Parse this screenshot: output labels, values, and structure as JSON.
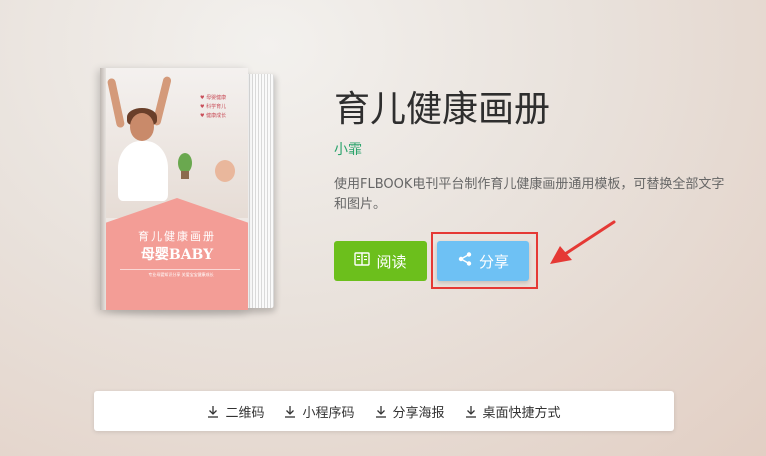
{
  "book": {
    "title": "育儿健康画册",
    "author": "小霏",
    "description": "使用FLBOOK电刊平台制作育儿健康画册通用模板，可替换全部文字和图片。",
    "cover": {
      "title": "育儿健康画册",
      "subtitle": "母婴BABY",
      "bullets": [
        "母婴健康",
        "科学育儿",
        "健康成长"
      ],
      "small_text": "专业母婴知识分享 关爱宝宝健康成长"
    }
  },
  "actions": {
    "read_label": "阅读",
    "share_label": "分享"
  },
  "bottom_bar": {
    "items": [
      "二维码",
      "小程序码",
      "分享海报",
      "桌面快捷方式"
    ]
  },
  "colors": {
    "read_button": "#6cbf1c",
    "share_button": "#6ec1f4",
    "author": "#2aa36b",
    "highlight": "#e53935",
    "cover_pink": "#f39d96"
  },
  "icons": {
    "read": "book-open-icon",
    "share": "share-icon",
    "download": "download-icon"
  }
}
